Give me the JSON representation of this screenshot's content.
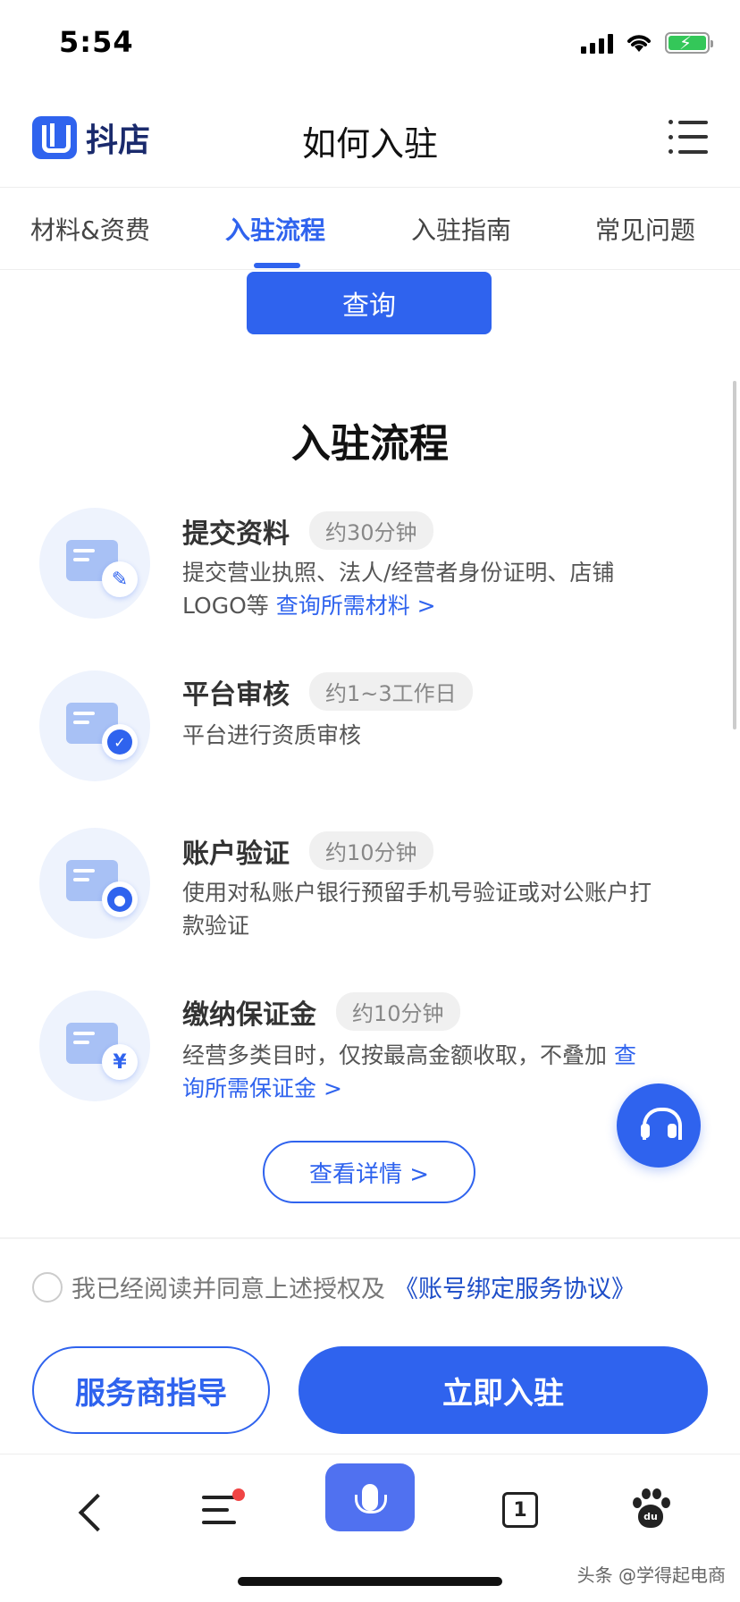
{
  "status_bar": {
    "time": "5:54"
  },
  "header": {
    "brand": "抖店",
    "title": "如何入驻"
  },
  "tabs": [
    {
      "label": "材料&资费",
      "active": false
    },
    {
      "label": "入驻流程",
      "active": true
    },
    {
      "label": "入驻指南",
      "active": false
    },
    {
      "label": "常见问题",
      "active": false
    }
  ],
  "query_button": "查询",
  "section_title": "入驻流程",
  "steps": [
    {
      "title": "提交资料",
      "duration": "约30分钟",
      "desc": "提交营业执照、法人/经营者身份证明、店铺LOGO等",
      "link": "查询所需材料 >",
      "icon": "document-edit-icon"
    },
    {
      "title": "平台审核",
      "duration": "约1~3工作日",
      "desc": "平台进行资质审核",
      "link": "",
      "icon": "laptop-shield-icon"
    },
    {
      "title": "账户验证",
      "duration": "约10分钟",
      "desc": "使用对私账户银行预留手机号验证或对公账户打款验证",
      "link": "",
      "icon": "id-card-user-icon"
    },
    {
      "title": "缴纳保证金",
      "duration": "约10分钟",
      "desc": "经营多类目时，仅按最高金额收取，不叠加",
      "link": "查询所需保证金 >",
      "icon": "document-yuan-icon"
    }
  ],
  "detail_button": "查看详情 >",
  "agreement": {
    "text": "我已经阅读并同意上述授权及",
    "link": "《账号绑定服务协议》",
    "checked": false
  },
  "guide_button": "服务商指导",
  "join_button": "立即入驻",
  "browser": {
    "tab_count": "1",
    "paw_text": "du"
  },
  "watermark": "头条 @学得起电商",
  "colors": {
    "accent": "#2f63ee",
    "link": "#1e4ec8"
  }
}
